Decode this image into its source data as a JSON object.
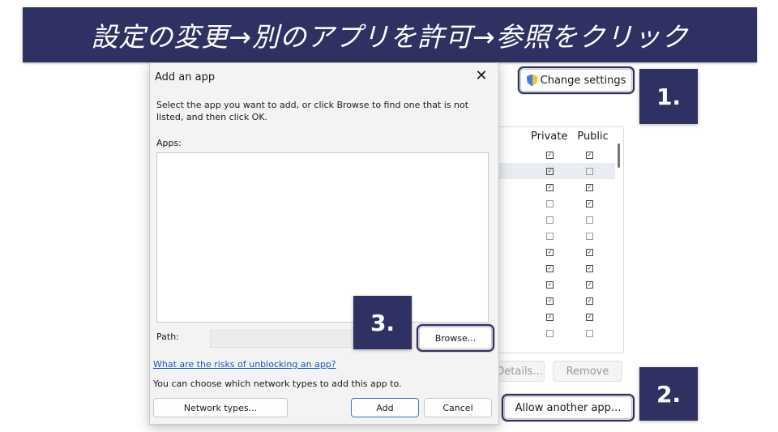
{
  "banner": {
    "text": "設定の変更→別のアプリを許可→参照をクリック"
  },
  "firewall": {
    "change_settings": "Change settings",
    "col_private": "Private",
    "col_public": "Public",
    "rows": [
      {
        "private": true,
        "public": true
      },
      {
        "private": true,
        "public": false
      },
      {
        "private": true,
        "public": true
      },
      {
        "private": false,
        "public": true
      },
      {
        "private": false,
        "public": false
      },
      {
        "private": false,
        "public": false
      },
      {
        "private": true,
        "public": true
      },
      {
        "private": true,
        "public": true
      },
      {
        "private": true,
        "public": true
      },
      {
        "private": true,
        "public": true
      },
      {
        "private": true,
        "public": true
      },
      {
        "private": false,
        "public": false
      }
    ],
    "details_label": "Details...",
    "remove_label": "Remove",
    "allow_another_label": "Allow another app..."
  },
  "dialog": {
    "title": "Add an app",
    "close_glyph": "✕",
    "instructions": "Select the app you want to add, or click Browse to find one that is not listed, and then click OK.",
    "apps_label": "Apps:",
    "path_label": "Path:",
    "browse_label": "Browse...",
    "risk_link": "What are the risks of unblocking an app?",
    "network_info": "You can choose which network types to add this app to.",
    "network_types_label": "Network types...",
    "add_label": "Add",
    "cancel_label": "Cancel"
  },
  "callouts": {
    "one": "1.",
    "two": "2.",
    "three": "3."
  },
  "colors": {
    "accent": "#2f3162",
    "link": "#1a55c4"
  }
}
